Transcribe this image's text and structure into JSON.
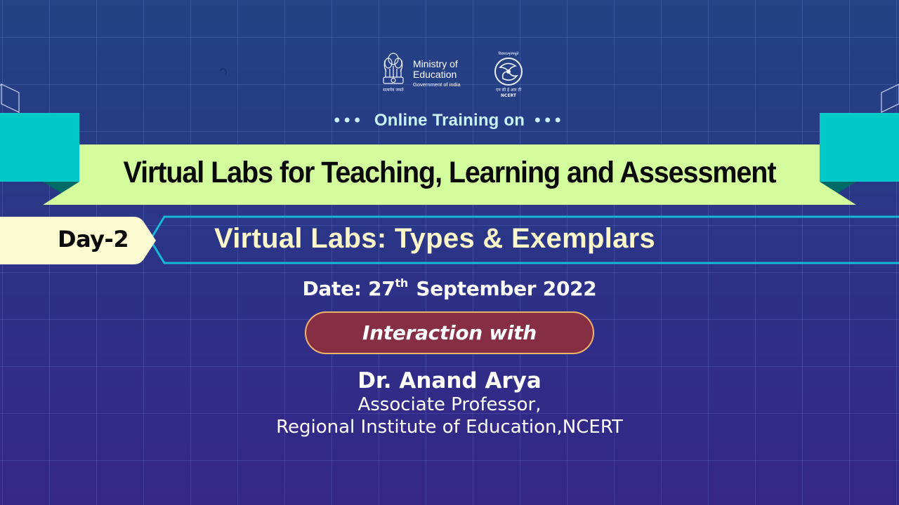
{
  "header": {
    "ministry": {
      "line1": "Ministry of",
      "line2": "Education",
      "line3": "Government of india",
      "emblem_icon": "national-emblem-icon",
      "emblem_caption": "सत्यमेव जयते"
    },
    "ncert": {
      "logo_icon": "ncert-logo-icon",
      "top_caption": "विद्ययाऽमृतमश्नुते",
      "bottom_caption_hi": "एन सी ई आर टी",
      "bottom_caption_en": "NCERT"
    }
  },
  "subtitle": {
    "dots_left": "•••",
    "text": "Online Training on",
    "dots_right": "•••"
  },
  "banner": {
    "title": "Virtual Labs for Teaching, Learning and Assessment"
  },
  "session": {
    "day_label": "Day-2",
    "topic": "Virtual Labs: Types & Exemplars"
  },
  "date": {
    "prefix": "Date: 27",
    "suffix_sup": "th",
    "rest": " September 2022"
  },
  "interaction": {
    "label": "Interaction with"
  },
  "speaker": {
    "name": "Dr. Anand Arya",
    "designation": "Associate Professor,",
    "institution": "Regional Institute of Education,NCERT"
  },
  "colors": {
    "background_top": "#234382",
    "background_bottom": "#362688",
    "ribbon": "#d3fc9c",
    "ribbon_accent": "#00c9c9",
    "ribbon_shadow": "#006b66",
    "day_tag": "#fcfbd2",
    "day_outline": "#17b8d6",
    "topic_text": "#fcf7c9",
    "pill_fill": "#862e44",
    "pill_border": "#f2b36b",
    "subtitle_text": "#c9f1f6"
  }
}
